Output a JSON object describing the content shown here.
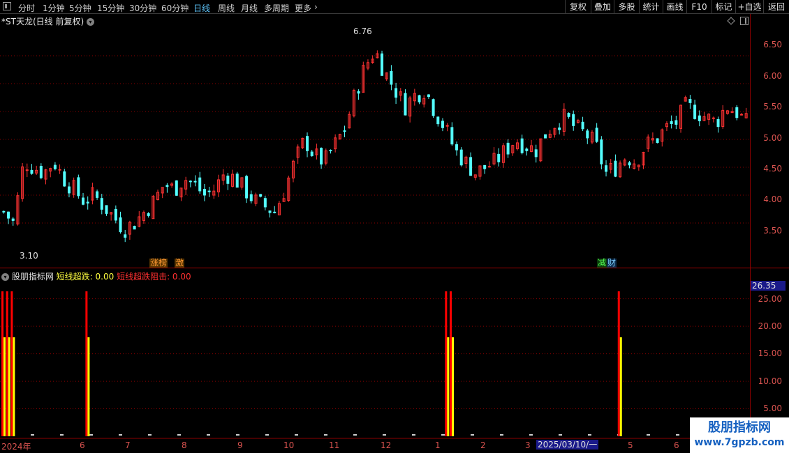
{
  "toolbar": {
    "periods": [
      "分时",
      "1分钟",
      "5分钟",
      "15分钟",
      "30分钟",
      "60分钟",
      "日线",
      "周线",
      "月线",
      "多周期",
      "更多"
    ],
    "active_period": "日线",
    "right_buttons": [
      "复权",
      "叠加",
      "多股",
      "统计",
      "画线",
      "F10",
      "标记",
      "+自选",
      "返回"
    ]
  },
  "stock": {
    "title": "*ST天龙(日线 前复权)"
  },
  "price_axis": {
    "ticks": [
      "6.50",
      "6.00",
      "5.50",
      "5.00",
      "4.50",
      "4.00",
      "3.50"
    ],
    "high": "6.76",
    "low": "3.10"
  },
  "tags": {
    "zhangbang": "涨榜",
    "ji": "激",
    "jian": "减",
    "cai": "财"
  },
  "indicator": {
    "name": "股朋指标网",
    "s1_label": "短线超跌: 0.00",
    "s2_label": "短线超跌阻击: 0.00",
    "current_value": "26.35",
    "ticks": [
      "25.00",
      "20.00",
      "15.00",
      "10.00",
      "5.00"
    ]
  },
  "dates": {
    "labels": [
      "2024年",
      "6",
      "7",
      "8",
      "9",
      "10",
      "11",
      "12",
      "1",
      "2",
      "3",
      "5",
      "6"
    ],
    "cursor": "2025/03/10/一"
  },
  "watermark": {
    "title": "股朋指标网",
    "url": "www.7gpzb.com"
  },
  "colors": {
    "up": "#ff3232",
    "down": "#54ffff",
    "signal_yellow": "#ffff00",
    "signal_red": "#ff0000",
    "grid": "#8b0000"
  },
  "chart_data": {
    "type": "candlestick",
    "series_close_approx": [
      3.7,
      3.5,
      4.6,
      4.5,
      4.4,
      4.6,
      4.3,
      4.1,
      3.9,
      4.0,
      3.8,
      3.6,
      3.4,
      3.5,
      3.7,
      3.9,
      4.2,
      4.1,
      4.3,
      4.2,
      4.0,
      4.1,
      4.4,
      4.3,
      4.1,
      3.9,
      3.8,
      3.7,
      4.1,
      4.6,
      5.0,
      4.7,
      4.6,
      4.9,
      5.2,
      5.8,
      6.3,
      6.6,
      6.2,
      5.9,
      5.6,
      5.8,
      5.9,
      5.5,
      5.2,
      4.8,
      4.6,
      4.4,
      4.5,
      4.6,
      4.8,
      5.0,
      4.9,
      4.8,
      5.1,
      5.3,
      5.4,
      5.2,
      5.1,
      4.9,
      4.4,
      4.5,
      4.7,
      4.6,
      4.9,
      5.0,
      5.2,
      5.3,
      5.6,
      5.5,
      5.4,
      5.3,
      5.6,
      5.5,
      5.3
    ],
    "ylim": [
      3.0,
      7.0
    ],
    "indicator": {
      "ylim": [
        0,
        28
      ],
      "spikes": [
        {
          "x_index": 0,
          "red": 26.35,
          "yellow": 18
        },
        {
          "x_index": 1,
          "red": 26.35,
          "yellow": 18
        },
        {
          "x_index": 2,
          "red": 26.35,
          "yellow": 18
        },
        {
          "x_index": 18,
          "red": 26.35,
          "yellow": 18
        },
        {
          "x_index": 95,
          "red": 26.35,
          "yellow": 18
        },
        {
          "x_index": 96,
          "red": 26.35,
          "yellow": 18
        },
        {
          "x_index": 132,
          "red": 26.35,
          "yellow": 18
        }
      ]
    }
  }
}
